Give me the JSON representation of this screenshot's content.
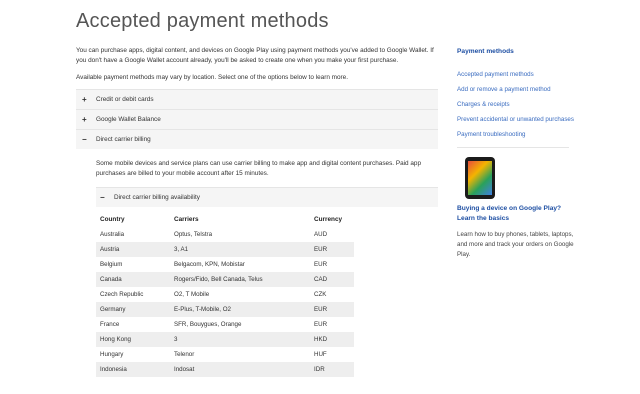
{
  "page": {
    "title": "Accepted payment methods"
  },
  "intro": {
    "paragraph1": "You can purchase apps, digital content, and devices on Google Play using payment methods you've added to Google Wallet. If you don't have a Google Wallet account already, you'll be asked to create one when you make your first purchase.",
    "paragraph2": "Available payment methods may vary by location. Select one of the options below to learn more."
  },
  "accordion": [
    {
      "sign": "+",
      "label": "Credit or debit cards"
    },
    {
      "sign": "+",
      "label": "Google Wallet Balance"
    },
    {
      "sign": "−",
      "label": "Direct carrier billing"
    }
  ],
  "carrier": {
    "text": "Some mobile devices and service plans can use carrier billing to make app and digital content purchases. Paid app purchases are billed to your mobile account after 15 minutes.",
    "sub": {
      "sign": "−",
      "label": "Direct carrier billing availability"
    },
    "table": {
      "headers": [
        "Country",
        "Carriers",
        "Currency"
      ],
      "rows": [
        [
          "Australia",
          "Optus, Telstra",
          "AUD"
        ],
        [
          "Austria",
          "3, A1",
          "EUR"
        ],
        [
          "Belgium",
          "Belgacom, KPN, Mobistar",
          "EUR"
        ],
        [
          "Canada",
          "Rogers/Fido, Bell Canada, Telus",
          "CAD"
        ],
        [
          "Czech Republic",
          "O2, T Mobile",
          "CZK"
        ],
        [
          "Germany",
          "E-Plus, T-Mobile, O2",
          "EUR"
        ],
        [
          "France",
          "SFR, Bouygues, Orange",
          "EUR"
        ],
        [
          "Hong Kong",
          "3",
          "HKD"
        ],
        [
          "Hungary",
          "Telenor",
          "HUF"
        ],
        [
          "Indonesia",
          "Indosat",
          "IDR"
        ]
      ]
    }
  },
  "sidebar": {
    "heading": "Payment methods",
    "links": [
      "Accepted payment methods",
      "Add or remove a payment method",
      "Charges & receipts",
      "Prevent accidental or unwanted purchases",
      "Payment troubleshooting"
    ],
    "promo": {
      "icon": "phone-device-icon",
      "title": "Buying a device on Google Play? Learn the basics",
      "text": "Learn how to buy phones, tablets, laptops, and more and track your orders on Google Play."
    }
  }
}
